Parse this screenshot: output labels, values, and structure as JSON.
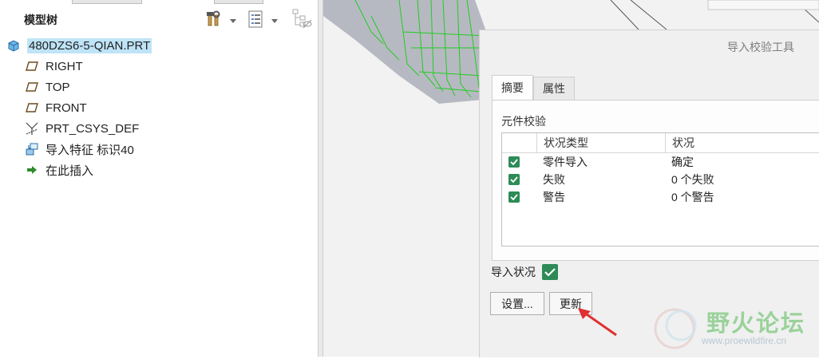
{
  "model_tree": {
    "title": "模型树",
    "nodes": [
      {
        "label": "480DZS6-5-QIAN.PRT",
        "icon": "part-icon"
      },
      {
        "label": "RIGHT",
        "icon": "datum-plane-icon"
      },
      {
        "label": "TOP",
        "icon": "datum-plane-icon"
      },
      {
        "label": "FRONT",
        "icon": "datum-plane-icon"
      },
      {
        "label": "PRT_CSYS_DEF",
        "icon": "coordinate-system-icon"
      },
      {
        "label": "导入特征 标识40",
        "icon": "import-feature-icon"
      },
      {
        "label": "在此插入",
        "icon": "insert-here-arrow-icon"
      }
    ]
  },
  "dialog": {
    "title": "导入校验工具",
    "tabs": [
      {
        "label": "摘要",
        "active": true
      },
      {
        "label": "属性",
        "active": false
      }
    ],
    "section_label": "元件校验",
    "table": {
      "headers": [
        "状况类型",
        "状况"
      ],
      "rows": [
        {
          "type": "零件导入",
          "status": "确定",
          "checked": true
        },
        {
          "type": "失败",
          "status": "0 个失败",
          "checked": true
        },
        {
          "type": "警告",
          "status": "0 个警告",
          "checked": true
        }
      ]
    },
    "import_status_label": "导入状况",
    "buttons": {
      "settings": "设置...",
      "update": "更新"
    }
  },
  "watermark": {
    "title": "野火论坛",
    "url": "www.proewildfire.cn"
  },
  "colors": {
    "selection": "#bfe4f7",
    "check_green": "#2e8b57",
    "mesh_green": "#22cc22",
    "arrow_red": "#e03030"
  }
}
